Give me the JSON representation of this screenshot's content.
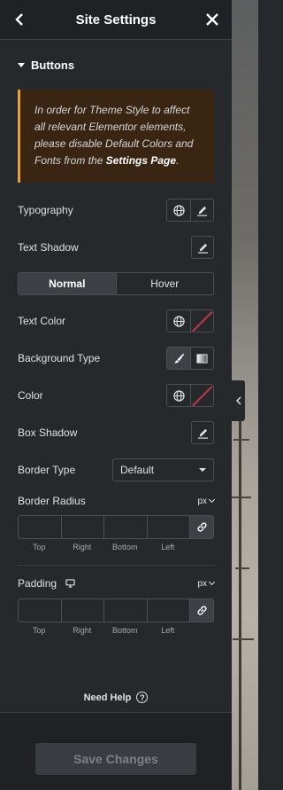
{
  "header": {
    "title": "Site Settings",
    "back_icon": "chevron-left-icon",
    "close_icon": "close-icon"
  },
  "section": {
    "title": "Buttons"
  },
  "notice": {
    "text_before": "In order for Theme Style to affect all relevant Elementor elements, please disable Default Colors and Fonts from the ",
    "link_text": "Settings Page",
    "text_after": "."
  },
  "controls": {
    "typography_label": "Typography",
    "text_shadow_label": "Text Shadow",
    "tabs": {
      "normal": "Normal",
      "hover": "Hover",
      "active": "Normal"
    },
    "text_color_label": "Text Color",
    "background_type_label": "Background Type",
    "color_label": "Color",
    "box_shadow_label": "Box Shadow",
    "border_type_label": "Border Type",
    "border_type_value": "Default",
    "border_radius_label": "Border Radius",
    "border_radius_unit": "px",
    "padding_label": "Padding",
    "padding_unit": "px",
    "dim_labels": {
      "top": "Top",
      "right": "Right",
      "bottom": "Bottom",
      "left": "Left"
    }
  },
  "help": {
    "label": "Need Help",
    "icon": "question-icon"
  },
  "footer": {
    "save_label": "Save Changes"
  },
  "colors": {
    "accent_notice_border": "#e9a13b",
    "notice_bg": "#3a2412",
    "panel_bg": "#26292c",
    "header_bg": "#1f2124",
    "unset_color_slash": "#c0394b"
  }
}
